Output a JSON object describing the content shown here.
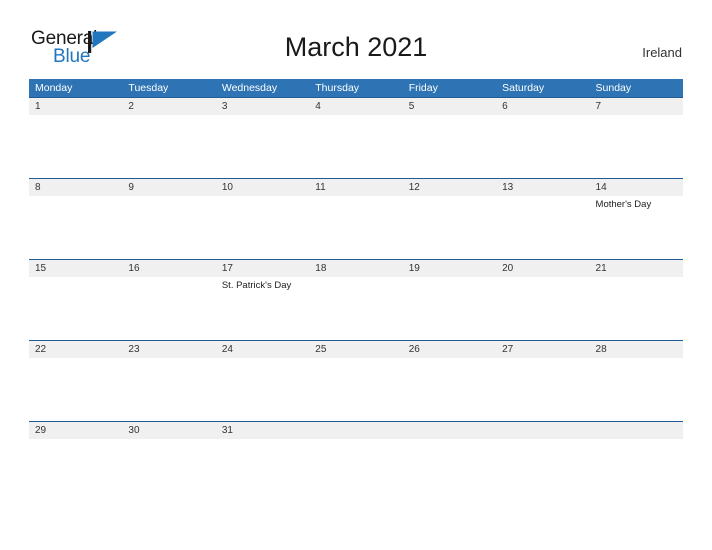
{
  "header": {
    "logo": {
      "word_one": "General",
      "word_two": "Blue",
      "mark": "blue-flag-triangle",
      "accent_color": "#2176bd"
    },
    "title": "March 2021",
    "country": "Ireland"
  },
  "calendar": {
    "header_color": "#2e74b5",
    "row_line_color": "#1f5c96",
    "date_band_color": "#f0f0f0",
    "day_names": [
      "Monday",
      "Tuesday",
      "Wednesday",
      "Thursday",
      "Friday",
      "Saturday",
      "Sunday"
    ],
    "weeks": [
      {
        "days": [
          {
            "date": "1",
            "event": ""
          },
          {
            "date": "2",
            "event": ""
          },
          {
            "date": "3",
            "event": ""
          },
          {
            "date": "4",
            "event": ""
          },
          {
            "date": "5",
            "event": ""
          },
          {
            "date": "6",
            "event": ""
          },
          {
            "date": "7",
            "event": ""
          }
        ]
      },
      {
        "days": [
          {
            "date": "8",
            "event": ""
          },
          {
            "date": "9",
            "event": ""
          },
          {
            "date": "10",
            "event": ""
          },
          {
            "date": "11",
            "event": ""
          },
          {
            "date": "12",
            "event": ""
          },
          {
            "date": "13",
            "event": ""
          },
          {
            "date": "14",
            "event": "Mother's Day"
          }
        ]
      },
      {
        "days": [
          {
            "date": "15",
            "event": ""
          },
          {
            "date": "16",
            "event": ""
          },
          {
            "date": "17",
            "event": "St. Patrick's Day"
          },
          {
            "date": "18",
            "event": ""
          },
          {
            "date": "19",
            "event": ""
          },
          {
            "date": "20",
            "event": ""
          },
          {
            "date": "21",
            "event": ""
          }
        ]
      },
      {
        "days": [
          {
            "date": "22",
            "event": ""
          },
          {
            "date": "23",
            "event": ""
          },
          {
            "date": "24",
            "event": ""
          },
          {
            "date": "25",
            "event": ""
          },
          {
            "date": "26",
            "event": ""
          },
          {
            "date": "27",
            "event": ""
          },
          {
            "date": "28",
            "event": ""
          }
        ]
      },
      {
        "days": [
          {
            "date": "29",
            "event": ""
          },
          {
            "date": "30",
            "event": ""
          },
          {
            "date": "31",
            "event": ""
          },
          {
            "date": "",
            "event": ""
          },
          {
            "date": "",
            "event": ""
          },
          {
            "date": "",
            "event": ""
          },
          {
            "date": "",
            "event": ""
          }
        ]
      }
    ]
  }
}
